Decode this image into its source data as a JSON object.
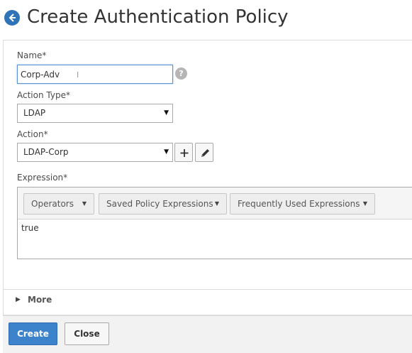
{
  "header": {
    "title": "Create Authentication Policy",
    "back_icon": "back-arrow-icon"
  },
  "form": {
    "name": {
      "label": "Name*",
      "value": "Corp-Adv",
      "help_glyph": "?"
    },
    "action_type": {
      "label": "Action Type*",
      "selected": "LDAP"
    },
    "action": {
      "label": "Action*",
      "selected": "LDAP-Corp",
      "add_icon": "plus-icon",
      "edit_icon": "pencil-icon"
    },
    "expression": {
      "label": "Expression*",
      "toolbar": {
        "operators": "Operators",
        "saved_policy_expressions": "Saved Policy Expressions",
        "frequently_used_expressions": "Frequently Used Expressions"
      },
      "value": "true"
    }
  },
  "more": {
    "label": "More"
  },
  "footer": {
    "create_label": "Create",
    "close_label": "Close"
  },
  "colors": {
    "accent": "#3d83cc",
    "back_button": "#2f73b8"
  }
}
